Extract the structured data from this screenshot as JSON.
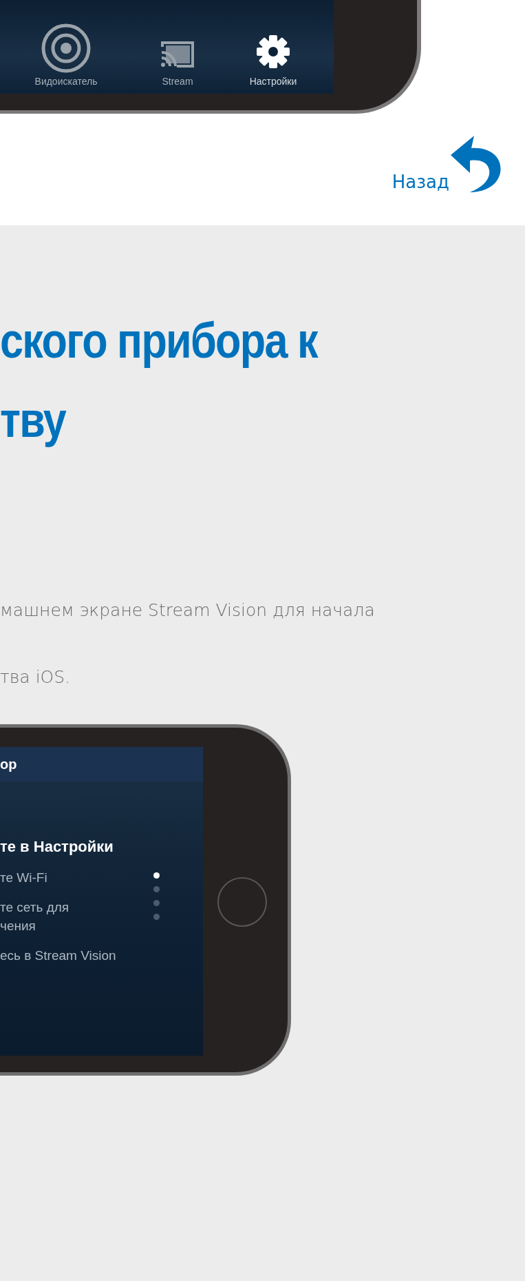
{
  "top_phone": {
    "nav": [
      {
        "label": "Видоискатель",
        "kind": "target",
        "selected": false
      },
      {
        "label": "Stream",
        "kind": "cast",
        "selected": false
      },
      {
        "label": "Настройки",
        "kind": "gear",
        "selected": true
      }
    ]
  },
  "back_link": {
    "label": "Назад"
  },
  "article": {
    "heading_lines": [
      "ского прибора к",
      "тву"
    ],
    "paragraphs": [
      "машнем экране Stream Vision для начала",
      "тва iOS."
    ]
  },
  "phone": {
    "header": "ор",
    "title": "те в Настройки",
    "steps": [
      {
        "lines": [
          "те Wi-Fi"
        ]
      },
      {
        "lines": [
          "те сеть для",
          "чения"
        ]
      },
      {
        "lines": [
          "есь в Stream Vision"
        ]
      }
    ],
    "pagination": [
      {
        "selected": true
      },
      {
        "selected": false
      },
      {
        "selected": false
      },
      {
        "selected": false
      }
    ]
  }
}
